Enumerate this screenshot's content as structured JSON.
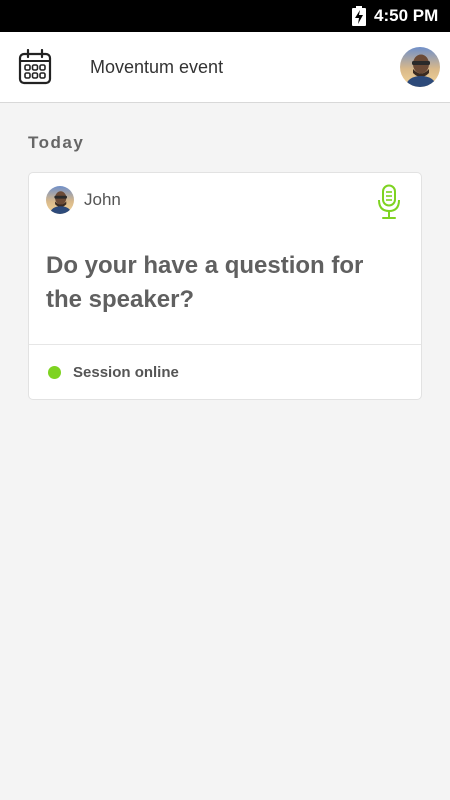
{
  "status_bar": {
    "time": "4:50 PM",
    "battery_icon": "battery-charging-icon"
  },
  "app_bar": {
    "title": "Moventum event",
    "calendar_icon": "calendar-icon",
    "profile_avatar": "user-avatar"
  },
  "feed": {
    "section_title": "Today",
    "cards": [
      {
        "author": "John",
        "question": "Do your have a question for the speaker?",
        "mic_icon": "microphone-icon",
        "status": "Session online",
        "status_color": "#7ed321"
      }
    ]
  },
  "colors": {
    "background": "#f4f4f4",
    "accent_green": "#7ed321",
    "status_bar": "#000000"
  }
}
